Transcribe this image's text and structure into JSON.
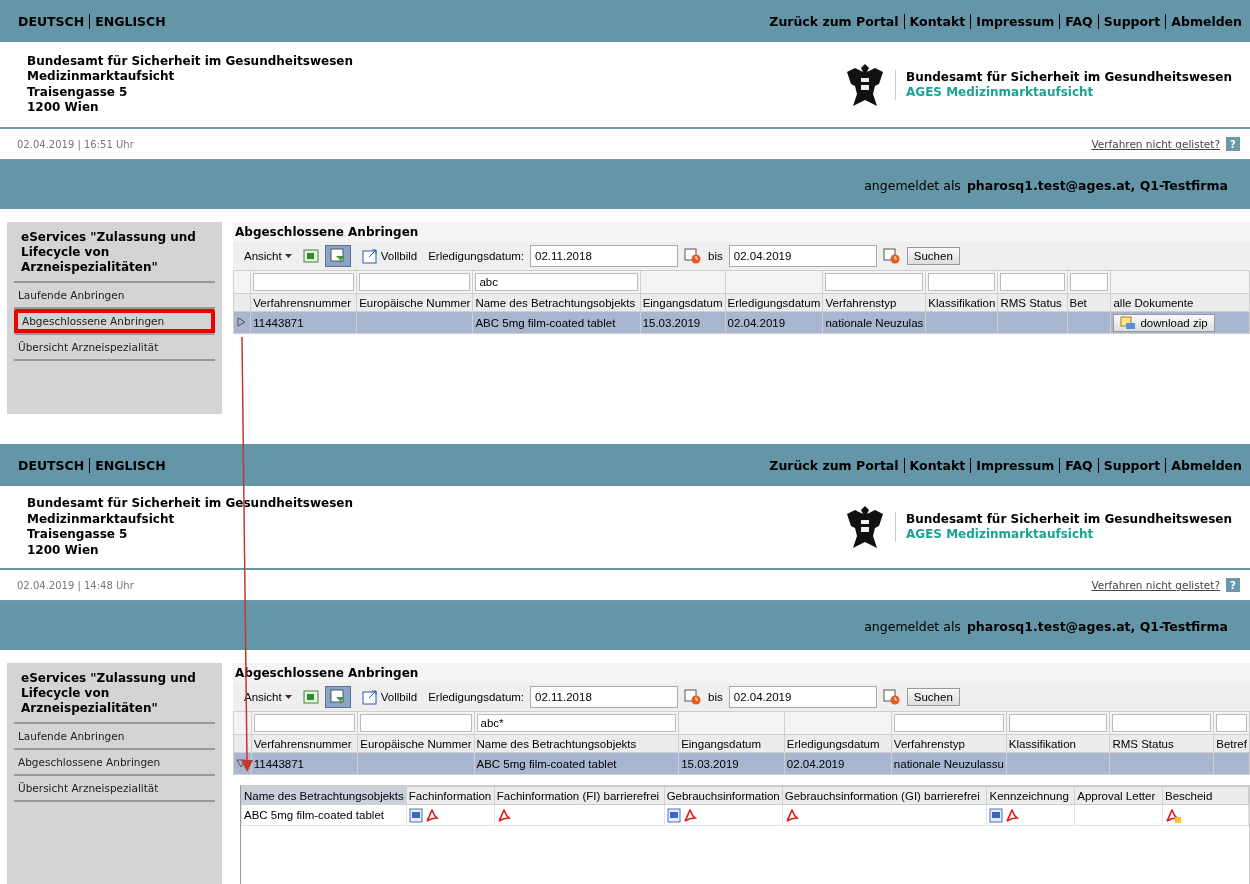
{
  "screens": [
    {
      "language_links": [
        "DEUTSCH",
        "ENGLISCH"
      ],
      "top_links": [
        "Zurück zum Portal",
        "Kontakt",
        "Impressum",
        "FAQ",
        "Support",
        "Abmelden"
      ],
      "address_lines": [
        "Bundesamt für Sicherheit im Gesundheitswesen",
        "Medizinmarktaufsicht",
        "Traisengasse 5",
        "1200 Wien"
      ],
      "org_name": "Bundesamt für Sicherheit im Gesundheitswesen",
      "org_unit": "AGES Medizinmarktaufsicht",
      "timestamp": "02.04.2019 | 16:51 Uhr",
      "help_link": "Verfahren nicht gelistet?",
      "help_icon": "?",
      "login_prefix": "angemeldet als",
      "login_user": "pharosq1.test@ages.at, Q1-Testfirma",
      "sidebar": {
        "title": "eServices \"Zulassung und Lifecycle von Arzneispezialitäten\"",
        "items": [
          {
            "label": "Laufende Anbringen",
            "highlighted": false
          },
          {
            "label": "Abgeschlossene Anbringen",
            "highlighted": true
          },
          {
            "label": "Übersicht Arzneispezialität",
            "highlighted": false
          }
        ]
      },
      "content_title": "Abgeschlossene Anbringen",
      "toolbar": {
        "view_menu": "Ansicht",
        "filter_active": true,
        "fullscreen": "Vollbild",
        "date_label": "Erledigungsdatum:",
        "date_from": "02.11.2018",
        "to_label": "bis",
        "date_to": "02.04.2019",
        "search": "Suchen"
      },
      "table": {
        "columns": [
          {
            "label": "Verfahrensnummer",
            "filter": true
          },
          {
            "label": "Europäische Nummer",
            "filter": true
          },
          {
            "label": "Name des Betrachtungsobjekts",
            "filter": true,
            "filter_value": "abc"
          },
          {
            "label": "Eingangsdatum",
            "filter": false
          },
          {
            "label": "Erledigungsdatum",
            "filter": false
          },
          {
            "label": "Verfahrenstyp",
            "filter": true
          },
          {
            "label": "Klassifikation",
            "filter": true
          },
          {
            "label": "RMS Status",
            "filter": true
          },
          {
            "label": "Bet",
            "filter": true
          },
          {
            "label": "alle Dokumente",
            "filter": false
          }
        ],
        "rows": [
          {
            "expanded": false,
            "selected": true,
            "cells": [
              "11443871",
              null,
              "ABC 5mg film-coated tablet",
              "15.03.2019",
              "02.04.2019",
              "nationale Neuzulas",
              null,
              null,
              null,
              null
            ],
            "download_button": "download zip"
          }
        ]
      }
    },
    {
      "language_links": [
        "DEUTSCH",
        "ENGLISCH"
      ],
      "top_links": [
        "Zurück zum Portal",
        "Kontakt",
        "Impressum",
        "FAQ",
        "Support",
        "Abmelden"
      ],
      "address_lines": [
        "Bundesamt für Sicherheit im Gesundheitswesen",
        "Medizinmarktaufsicht",
        "Traisengasse 5",
        "1200 Wien"
      ],
      "org_name": "Bundesamt für Sicherheit im Gesundheitswesen",
      "org_unit": "AGES Medizinmarktaufsicht",
      "timestamp": "02.04.2019 | 14:48 Uhr",
      "help_link": "Verfahren nicht gelistet?",
      "help_icon": "?",
      "login_prefix": "angemeldet als",
      "login_user": "pharosq1.test@ages.at, Q1-Testfirma",
      "sidebar": {
        "title": "eServices \"Zulassung und Lifecycle von Arzneispezialitäten\"",
        "items": [
          {
            "label": "Laufende Anbringen",
            "highlighted": false
          },
          {
            "label": "Abgeschlossene Anbringen",
            "highlighted": false
          },
          {
            "label": "Übersicht Arzneispezialität",
            "highlighted": false
          }
        ]
      },
      "content_title": "Abgeschlossene Anbringen",
      "toolbar": {
        "view_menu": "Ansicht",
        "filter_active": true,
        "fullscreen": "Vollbild",
        "date_label": "Erledigungsdatum:",
        "date_from": "02.11.2018",
        "to_label": "bis",
        "date_to": "02.04.2019",
        "search": "Suchen"
      },
      "table": {
        "columns": [
          {
            "label": "Verfahrensnummer",
            "filter": true
          },
          {
            "label": "Europäische Nummer",
            "filter": true
          },
          {
            "label": "Name des Betrachtungsobjekts",
            "filter": true,
            "filter_value": "abc*"
          },
          {
            "label": "Eingangsdatum",
            "filter": false
          },
          {
            "label": "Erledigungsdatum",
            "filter": false
          },
          {
            "label": "Verfahrenstyp",
            "filter": true
          },
          {
            "label": "Klassifikation",
            "filter": true
          },
          {
            "label": "RMS Status",
            "filter": true
          },
          {
            "label": "Betref",
            "filter": true
          }
        ],
        "rows": [
          {
            "expanded": true,
            "selected": true,
            "cells": [
              "11443871",
              null,
              "ABC 5mg film-coated tablet",
              "15.03.2019",
              "02.04.2019",
              "nationale Neuzulassu",
              null,
              null,
              null
            ]
          }
        ]
      },
      "detail": {
        "columns": [
          "Name des Betrachtungsobjekts",
          "Fachinformation",
          "Fachinformation (FI) barrierefrei",
          "Gebrauchsinformation",
          "Gebrauchsinformation (GI) barrierefrei",
          "Kennzeichnung",
          "Approval Letter",
          "Bescheid"
        ],
        "rows": [
          {
            "cells": [
              {
                "kind": "text",
                "text": "ABC 5mg film-coated tablet"
              },
              {
                "kind": "icons",
                "icons": [
                  {
                    "kind": "word"
                  },
                  {
                    "kind": "pdf"
                  }
                ]
              },
              {
                "kind": "icons",
                "icons": [
                  {
                    "kind": "pdf"
                  }
                ]
              },
              {
                "kind": "icons",
                "icons": [
                  {
                    "kind": "word"
                  },
                  {
                    "kind": "pdf"
                  }
                ]
              },
              {
                "kind": "icons",
                "icons": [
                  {
                    "kind": "pdf"
                  }
                ]
              },
              {
                "kind": "icons",
                "icons": [
                  {
                    "kind": "word"
                  },
                  {
                    "kind": "pdf"
                  }
                ]
              },
              {
                "kind": "empty"
              },
              {
                "kind": "icons",
                "icons": [
                  {
                    "kind": "pdf-stamped"
                  }
                ]
              }
            ]
          }
        ]
      }
    }
  ]
}
